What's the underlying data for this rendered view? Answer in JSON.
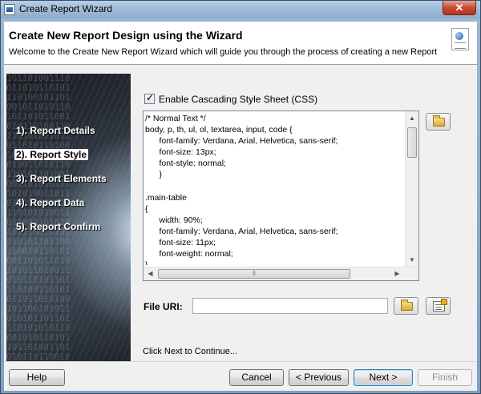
{
  "window": {
    "title": "Create Report Wizard",
    "close_glyph": "✕"
  },
  "header": {
    "title": "Create New Report Design using the Wizard",
    "description": "Welcome to the Create New Report Wizard which will guide you through the process of creating a new Report",
    "icon": "report-document-icon"
  },
  "nav": {
    "steps": [
      {
        "label": "1). Report Details",
        "active": false
      },
      {
        "label": "2). Report Style",
        "active": true
      },
      {
        "label": "3). Report Elements",
        "active": false
      },
      {
        "label": "4). Report Data",
        "active": false
      },
      {
        "label": "5). Report Confirm",
        "active": false
      }
    ]
  },
  "css": {
    "enable_label": "Enable Cascading Style Sheet (CSS)",
    "enabled": true,
    "lines": [
      "/* Normal Text */",
      "body, p, th, ul, ol, textarea, input, code {",
      "      font-family: Verdana, Arial, Helvetica, sans-serif;",
      "      font-size: 13px;",
      "      font-style: normal;",
      "      }",
      "",
      ".main-table",
      "{",
      "      width: 90%;",
      "      font-family: Verdana, Arial, Helvetica, sans-serif;",
      "      font-size: 11px;",
      "      font-weight: normal;",
      "}"
    ]
  },
  "file_uri": {
    "label": "File URI:",
    "value": "",
    "placeholder": ""
  },
  "status": {
    "text": "Click Next to Continue..."
  },
  "buttons": {
    "help": "Help",
    "cancel": "Cancel",
    "previous": "< Previous",
    "next": "Next >",
    "finish": "Finish"
  },
  "scroll_glyphs": {
    "up": "▲",
    "down": "▼",
    "left": "◀",
    "right": "▶",
    "grip_v": "≡",
    "grip_h": "⦀"
  }
}
